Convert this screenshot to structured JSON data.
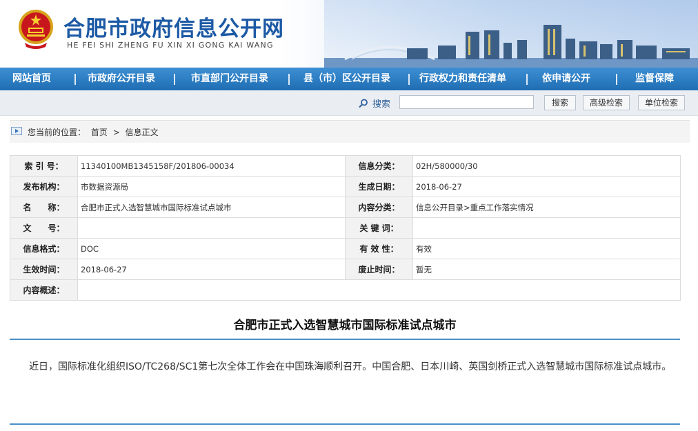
{
  "header": {
    "title": "合肥市政府信息公开网",
    "subtitle": "HE FEI SHI ZHENG FU XIN XI GONG KAI WANG"
  },
  "nav": {
    "items": [
      "网站首页",
      "市政府公开目录",
      "市直部门公开目录",
      "县（市）区公开目录",
      "行政权力和责任清单",
      "依申请公开",
      "监督保障"
    ]
  },
  "search": {
    "label": "搜索",
    "placeholder": "",
    "search_button": "搜索",
    "advanced_button": "高级检索",
    "unit_button": "单位检索"
  },
  "breadcrumb": {
    "prefix": "您当前的位置：",
    "home": "首页",
    "sep": ">",
    "current": "信息正文"
  },
  "meta": {
    "rows": [
      {
        "k1": "索 引 号：",
        "v1": "11340100MB1345158F/201806-00034",
        "k2": "信息分类：",
        "v2": "02H/580000/30"
      },
      {
        "k1": "发布机构：",
        "v1": "市数据资源局",
        "k2": "生成日期：",
        "v2": "2018-06-27"
      },
      {
        "k1": "名　　称：",
        "v1": "合肥市正式入选智慧城市国际标准试点城市",
        "k2": "内容分类：",
        "v2": "信息公开目录>重点工作落实情况"
      },
      {
        "k1": "文　　号：",
        "v1": "",
        "k2": "关 键 词：",
        "v2": ""
      },
      {
        "k1": "信息格式：",
        "v1": "DOC",
        "k2": "有 效 性：",
        "v2": "有效"
      },
      {
        "k1": "生效时间：",
        "v1": "2018-06-27",
        "k2": "废止时间：",
        "v2": "暂无"
      },
      {
        "k1": "内容概述：",
        "v1": ""
      }
    ]
  },
  "article": {
    "title": "合肥市正式入选智慧城市国际标准试点城市",
    "body": "近日，国际标准化组织ISO/TC268/SC1第七次全体工作会在中国珠海顺利召开。中国合肥、日本川崎、英国剑桥正式入选智慧城市国际标准试点城市。"
  },
  "colors": {
    "brand_blue": "#1d5aa5",
    "nav_blue": "#2a7cc4",
    "rule_blue": "#4a90c9"
  }
}
